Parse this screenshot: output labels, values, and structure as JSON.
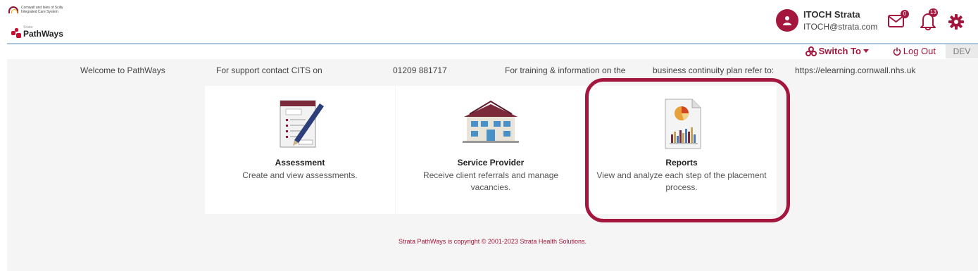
{
  "header": {
    "ics_logo_line1": "Cornwall and Isles of Scilly",
    "ics_logo_line2": "Integrated Care System",
    "pw_logo_small": "Strata",
    "pw_logo_name": "PathWays",
    "user_name": "ITOCH Strata",
    "user_email": "ITOCH@strata.com",
    "mail_count": "0",
    "notification_count": "13"
  },
  "subbar": {
    "switch_to_label": "Switch To",
    "logout_label": "Log Out",
    "env_label": "DEV"
  },
  "welcome": {
    "welcome_text": "Welcome to PathWays",
    "support_text": "For support contact CITS on",
    "phone": "01209 881717",
    "training_text": "For training & information on the",
    "continuity_text": "business continuity plan refer to:",
    "url": "https://elearning.cornwall.nhs.uk"
  },
  "cards": [
    {
      "title": "Assessment",
      "description": "Create and view assessments."
    },
    {
      "title": "Service Provider",
      "description": "Receive client referrals and manage vacancies."
    },
    {
      "title": "Reports",
      "description": "View and analyze each step of the placement process."
    }
  ],
  "footer": {
    "copyright": "Strata PathWays is copyright © 2001-2023 Strata Health Solutions."
  },
  "colors": {
    "brand": "#a4163d",
    "divider": "#a9c6de",
    "background": "#f5f5f5"
  }
}
